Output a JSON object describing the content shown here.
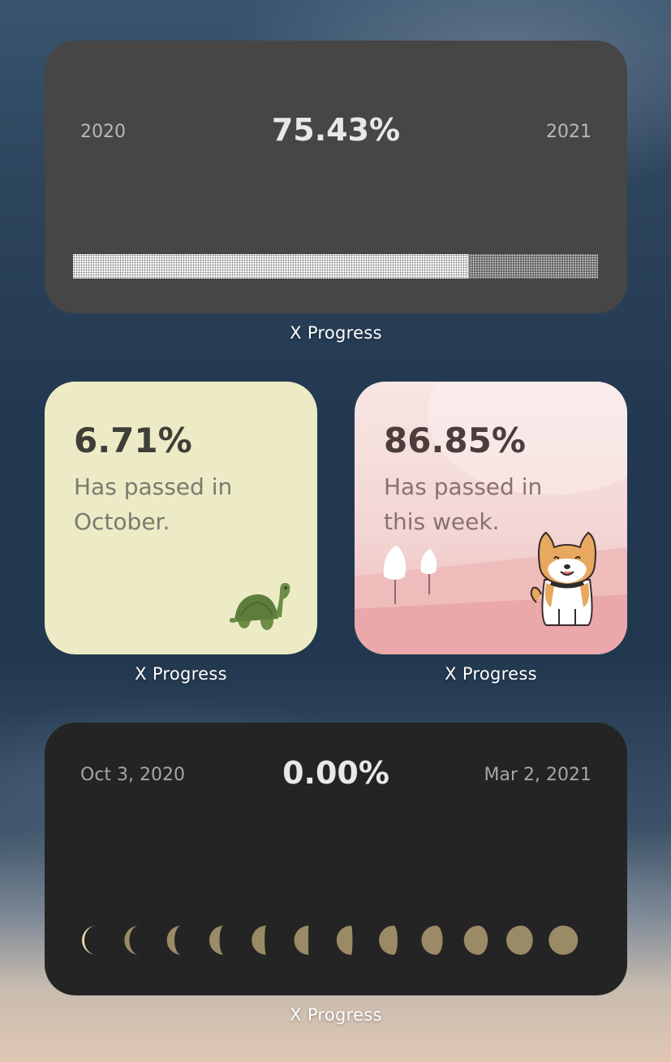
{
  "year_widget": {
    "start_label": "2020",
    "end_label": "2021",
    "percent": "75.43%",
    "progress": 0.7543,
    "caption": "X Progress"
  },
  "month_widget": {
    "percent": "6.71%",
    "line1": "Has passed in",
    "line2": "October.",
    "caption": "X Progress",
    "icon": "turtle-icon",
    "bg_color": "#ecebc5"
  },
  "week_widget": {
    "percent": "86.85%",
    "line1": "Has passed in",
    "line2": "this week.",
    "caption": "X Progress",
    "icon": "shiba-dog-icon",
    "bg_color": "#f3d6d4"
  },
  "moon_widget": {
    "start_label": "Oct 3, 2020",
    "end_label": "Mar 2, 2021",
    "percent": "0.00%",
    "caption": "X Progress",
    "phase_count": 12,
    "moon_color": "#9a8a66"
  }
}
